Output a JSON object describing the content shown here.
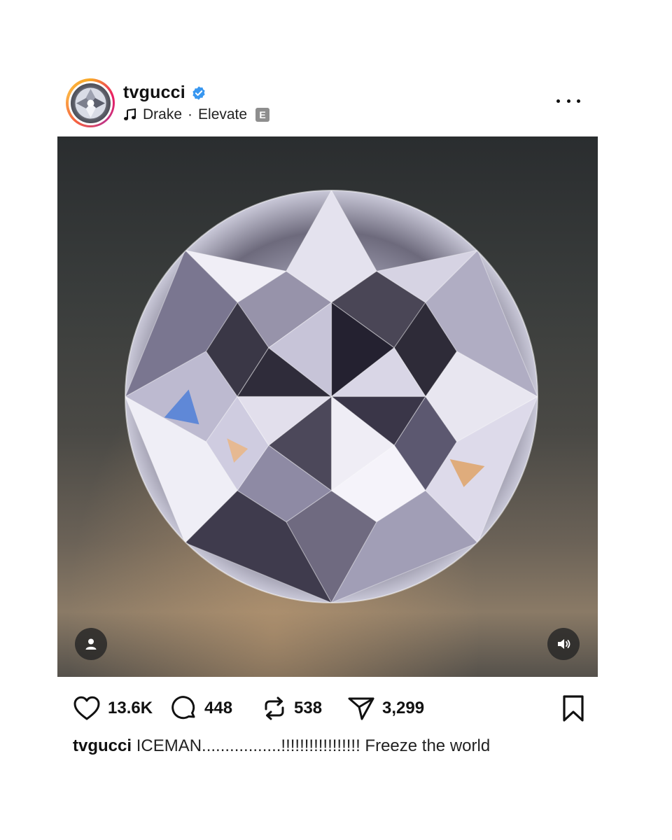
{
  "post": {
    "username": "tvgucci",
    "verified": true,
    "music": {
      "artist": "Drake",
      "separator": "·",
      "track": "Elevate",
      "explicit_badge": "E"
    },
    "media": {
      "subject": "diamond",
      "icons": {
        "user_tag": "user-tag-icon",
        "mute": "speaker-icon"
      }
    },
    "actions": {
      "likes": "13.6K",
      "comments": "448",
      "reposts": "538",
      "shares": "3,299"
    },
    "caption": {
      "username": "tvgucci",
      "text": "ICEMAN.................!!!!!!!!!!!!!!!!! Freeze the world"
    }
  },
  "colors": {
    "verified": "#3897f0",
    "explicit_badge": "#8e8e8e",
    "ring_start": "#f9a825",
    "ring_end": "#c13584"
  }
}
